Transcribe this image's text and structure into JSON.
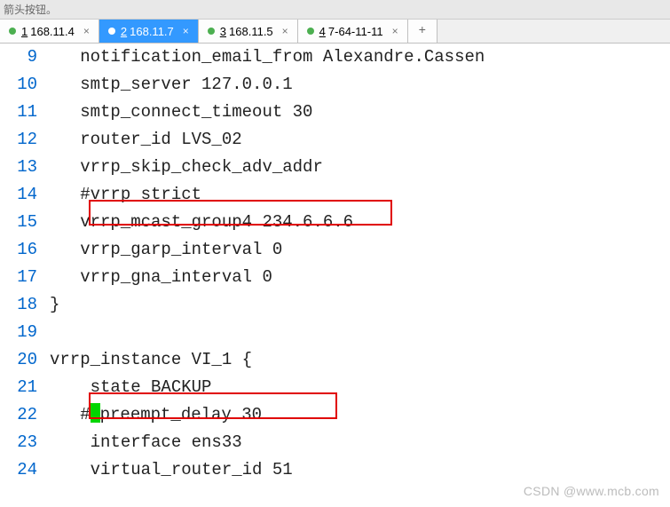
{
  "topbar": {
    "text": "箭头按钮。"
  },
  "tabs": {
    "items": [
      {
        "num": "1",
        "label": "168.11.4",
        "active": false
      },
      {
        "num": "2",
        "label": "168.11.7",
        "active": true
      },
      {
        "num": "3",
        "label": "168.11.5",
        "active": false
      },
      {
        "num": "4",
        "label": "7-64-11-11",
        "active": false
      }
    ],
    "add": "+"
  },
  "code": {
    "lines": [
      {
        "n": "9",
        "indent": "   ",
        "text": "notification_email_from Alexandre.Cassen"
      },
      {
        "n": "10",
        "indent": "   ",
        "text": "smtp_server 127.0.0.1"
      },
      {
        "n": "11",
        "indent": "   ",
        "text": "smtp_connect_timeout 30"
      },
      {
        "n": "12",
        "indent": "   ",
        "text": "router_id LVS_02"
      },
      {
        "n": "13",
        "indent": "   ",
        "text": "vrrp_skip_check_adv_addr"
      },
      {
        "n": "14",
        "indent": "   ",
        "text": "#vrrp_strict"
      },
      {
        "n": "15",
        "indent": "   ",
        "text": "vrrp_mcast_group4 234.6.6.6"
      },
      {
        "n": "16",
        "indent": "   ",
        "text": "vrrp_garp_interval 0"
      },
      {
        "n": "17",
        "indent": "   ",
        "text": "vrrp_gna_interval 0"
      },
      {
        "n": "18",
        "indent": "",
        "text": "}"
      },
      {
        "n": "19",
        "indent": "",
        "text": ""
      },
      {
        "n": "20",
        "indent": "",
        "text": "vrrp_instance VI_1 {"
      },
      {
        "n": "21",
        "indent": "    ",
        "text": "state BACKUP"
      },
      {
        "n": "22",
        "indent": "   ",
        "text": "#",
        "cursor": true,
        "after": "preempt_delay 30"
      },
      {
        "n": "23",
        "indent": "    ",
        "text": "interface ens33"
      },
      {
        "n": "24",
        "indent": "    ",
        "text": "virtual_router_id 51"
      }
    ]
  },
  "watermark": "CSDN @www.mcb.com"
}
